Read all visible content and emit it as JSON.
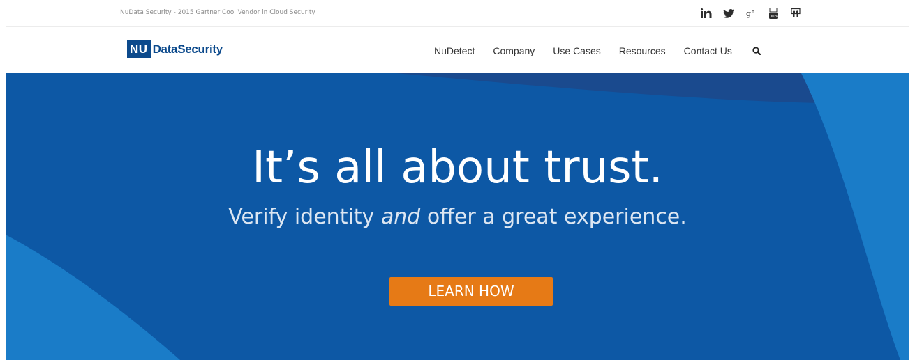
{
  "topbar": {
    "tagline": "NuData Security - 2015 Gartner Cool Vendor in Cloud Security",
    "social": [
      {
        "icon": "linkedin-icon"
      },
      {
        "icon": "twitter-icon"
      },
      {
        "icon": "google-plus-icon"
      },
      {
        "icon": "youtube-icon"
      },
      {
        "icon": "slideshare-icon"
      }
    ]
  },
  "header": {
    "logo_mark": "NU",
    "logo_text": "DataSecurity",
    "nav": {
      "item_1": "NuDetect",
      "item_2": "Company",
      "item_3": "Use Cases",
      "item_4": "Resources",
      "item_5": "Contact Us"
    },
    "search_icon": "search-icon"
  },
  "hero": {
    "title": "It’s all about trust.",
    "subtitle_before": "Verify identity ",
    "subtitle_emphasis": "and",
    "subtitle_after": " offer a great experience.",
    "cta_label": "LEARN HOW"
  },
  "colors": {
    "brand_blue": "#0c4a8c",
    "hero_blue": "#0d58a5",
    "hero_light_blue": "#1a7cc8",
    "hero_dark_blue": "#1a4a8e",
    "cta_orange": "#e67a16"
  }
}
